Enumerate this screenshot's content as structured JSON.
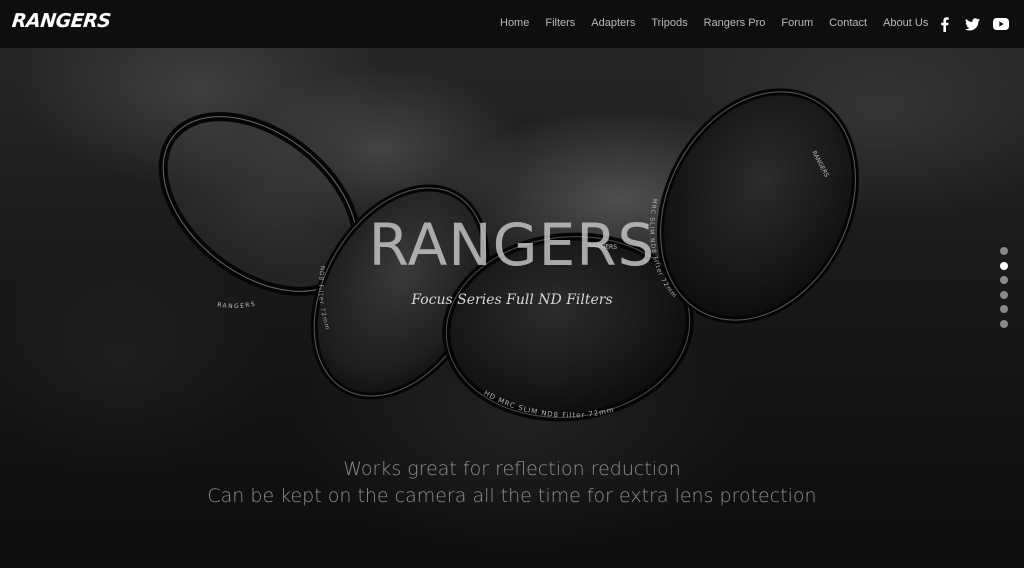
{
  "brand": {
    "logo_text": "RANGERS"
  },
  "nav": {
    "items": [
      {
        "label": "Home"
      },
      {
        "label": "Filters"
      },
      {
        "label": "Adapters"
      },
      {
        "label": "Tripods"
      },
      {
        "label": "Rangers Pro"
      },
      {
        "label": "Forum"
      },
      {
        "label": "Contact"
      },
      {
        "label": "About Us"
      }
    ],
    "social": [
      {
        "icon": "facebook-icon"
      },
      {
        "icon": "twitter-icon"
      },
      {
        "icon": "youtube-icon"
      }
    ]
  },
  "hero": {
    "title": "RANGERS",
    "subtitle": "Focus Series Full ND Filters",
    "taglines": [
      "Works great for reflection reduction",
      "Can be kept on the camera all the time for extra lens protection"
    ],
    "filter_ring_texts": [
      "RANGERS",
      "MRC SLIM",
      "ND8 Filter 72mm",
      "HD MRC SLIM ND8 Filter 72mm",
      "RANGERS",
      "MRC SLIM ND8 Filter 72mm"
    ]
  },
  "slider": {
    "count": 6,
    "active_index": 1
  },
  "colors": {
    "background": "#0b0b0b",
    "nav_text": "#b9b9b9",
    "active_dot": "#ffffff",
    "inactive_dot": "#8a8a8a"
  }
}
